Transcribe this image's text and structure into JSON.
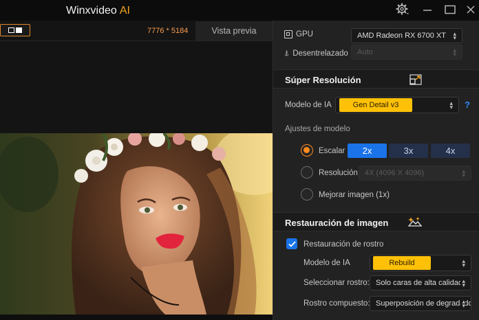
{
  "titlebar": {
    "app_name": "Winxvideo",
    "app_suffix": "AI",
    "icons": [
      "gear-icon",
      "minimize-icon",
      "maximize-icon",
      "close-icon"
    ]
  },
  "preview": {
    "resolution_text": "7776 * 5184",
    "tab_label": "Vista previa"
  },
  "hardware": {
    "gpu_label": "GPU",
    "gpu_value": "AMD Radeon RX 6700 XT",
    "deinterlace_label": "Desentrelazado",
    "deinterlace_value": "Auto"
  },
  "super_resolution": {
    "title": "Súper Resolución",
    "model_label": "Modelo de IA",
    "model_value": "Gen Detail v3",
    "settings_label": "Ajustes de modelo",
    "scale_label": "Escalar",
    "scale_options": [
      "2x",
      "3x",
      "4x"
    ],
    "scale_selected": "2x",
    "resolution_label": "Resolución",
    "resolution_value": "4X (4096 X 4096)",
    "enhance_label": "Mejorar imagen (1x)",
    "selected_mode": "Escalar",
    "help_mark": "?"
  },
  "restoration": {
    "title": "Restauración de imagen",
    "face_restore_label": "Restauración de rostro",
    "face_restore_checked": true,
    "model_label": "Modelo de IA",
    "model_value": "Rebuild",
    "select_face_label": "Seleccionar rostro:",
    "select_face_value": "Solo caras de alta calidad",
    "composite_label": "Rostro compuesto:",
    "composite_value": "Superposición de degradado"
  },
  "colors": {
    "accent_orange": "#f5a623",
    "accent_blue": "#1a73e8",
    "pill_yellow": "#ffc107",
    "panel_bg": "#222222",
    "titlebar_bg": "#0c0c0c"
  }
}
